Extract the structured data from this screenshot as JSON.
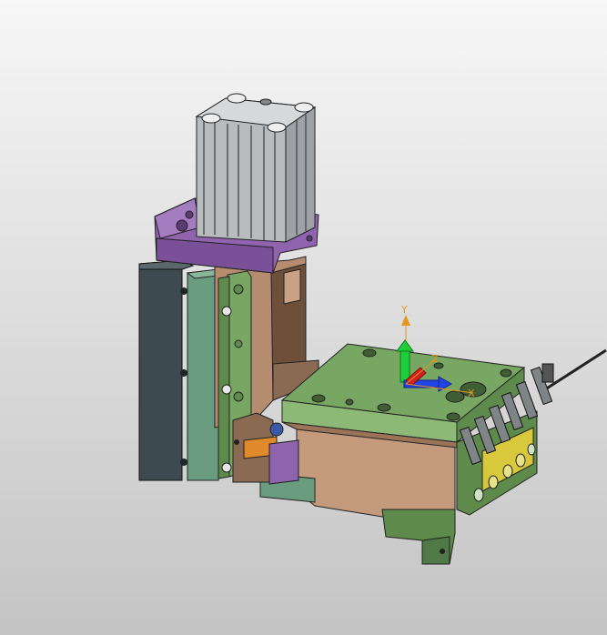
{
  "viewport": {
    "background_top": "#f7f7f7",
    "background_bottom": "#c4c4c4"
  },
  "colors": {
    "cylinder": "#b9bcbf",
    "cylinder_top": "#d6d8da",
    "purple": "#8f63ad",
    "dark_block": "#3d4a4f",
    "sage": "#6a9d80",
    "brown": "#b58c6f",
    "brown_dark": "#6e4f3a",
    "green_plate": "#78a763",
    "green_plate_dark": "#5e8a4c",
    "dark_green": "#4f7a47",
    "yellow": "#d7c93b",
    "orange": "#e08a2c",
    "blue_part": "#3a5aa8",
    "axis_y": "#1fcf3a",
    "axis_x": "#2244e6",
    "axis_z": "#d62020",
    "triad_orange": "#e6961e"
  },
  "triad": {
    "y_label": "Y",
    "x_label": "X",
    "z_label": "Z"
  }
}
